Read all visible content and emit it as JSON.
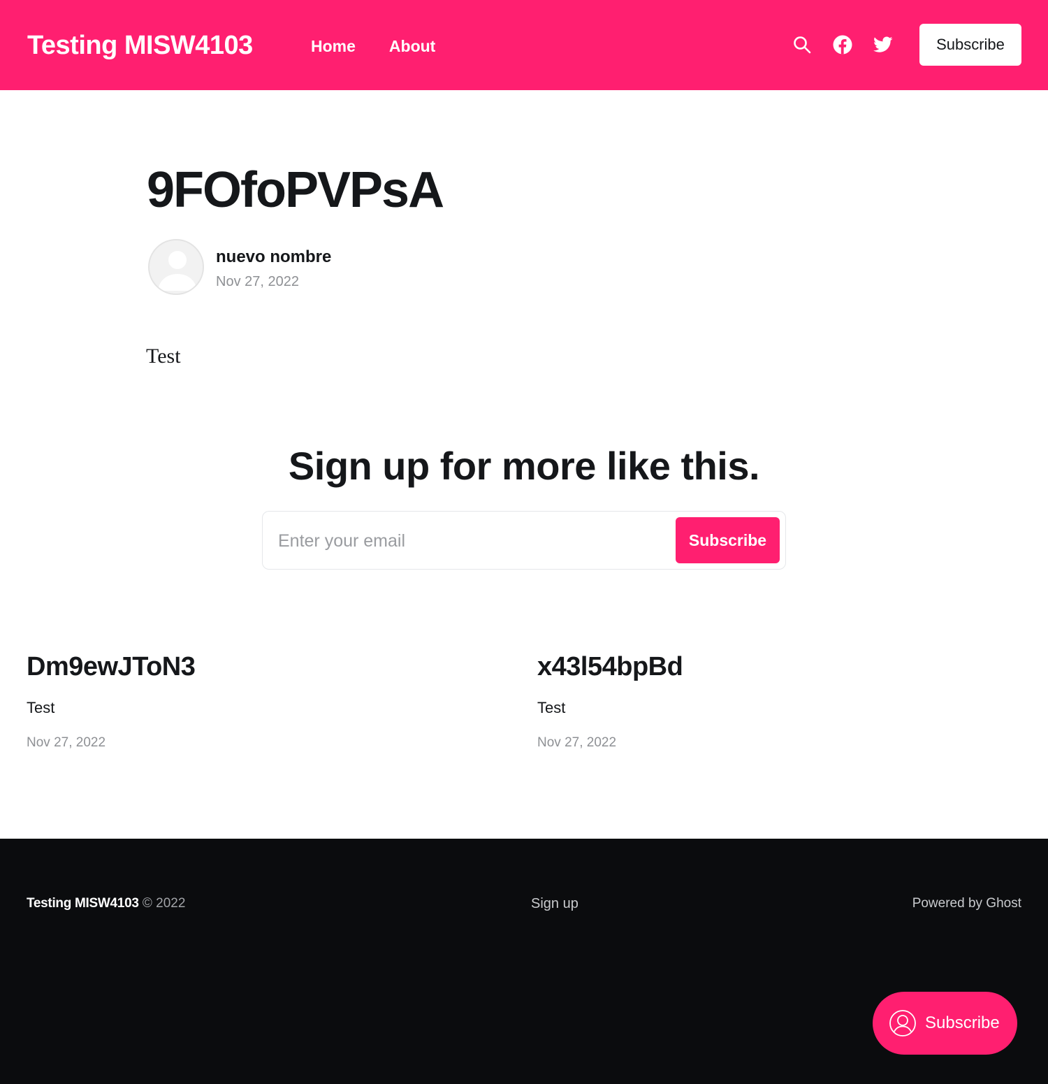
{
  "header": {
    "brand": "Testing MISW4103",
    "nav": [
      {
        "label": "Home"
      },
      {
        "label": "About"
      }
    ],
    "icons": [
      "search-icon",
      "facebook-icon",
      "twitter-icon"
    ],
    "subscribe_label": "Subscribe",
    "background_color": "#ff1f70"
  },
  "article": {
    "title": "9FOfoPVPsA",
    "author": "nuevo nombre",
    "date": "Nov 27, 2022",
    "body": "Test"
  },
  "cta": {
    "title": "Sign up for more like this.",
    "email_placeholder": "Enter your email",
    "button_label": "Subscribe"
  },
  "related_posts": [
    {
      "title": "Dm9ewJToN3",
      "excerpt": "Test",
      "date": "Nov 27, 2022"
    },
    {
      "title": "x43l54bpBd",
      "excerpt": "Test",
      "date": "Nov 27, 2022"
    }
  ],
  "footer": {
    "brand": "Testing MISW4103",
    "copyright": "© 2022",
    "signup_label": "Sign up",
    "powered_by": "Powered by Ghost",
    "background_color": "#0b0c0e"
  },
  "portal": {
    "button_label": "Subscribe"
  }
}
